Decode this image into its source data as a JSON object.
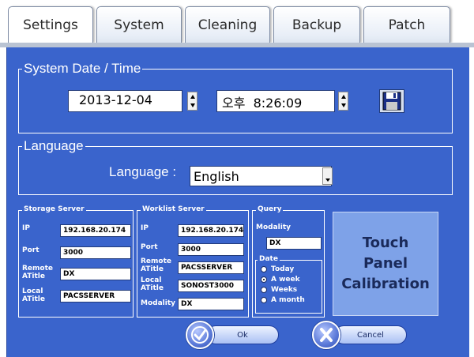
{
  "tabs": [
    "Settings",
    "System",
    "Cleaning",
    "Backup",
    "Patch"
  ],
  "datetime": {
    "title": "System Date / Time",
    "date": "2013-12-04",
    "time": "오후  8:26:09"
  },
  "language": {
    "group_title": "Language",
    "label": "Language :",
    "value": "English"
  },
  "storage": {
    "title": "Storage Server",
    "ip_label": "IP",
    "ip": "192.168.20.174",
    "port_label": "Port",
    "port": "3000",
    "remote_label1": "Remote",
    "remote_label2": "ATitle",
    "remote": "DX",
    "local_label1": "Local",
    "local_label2": "ATitle",
    "local": "PACSSERVER"
  },
  "worklist": {
    "title": "Worklist Server",
    "ip_label": "IP",
    "ip": "192.168.20.174",
    "port_label": "Port",
    "port": "3000",
    "remote_label1": "Remote",
    "remote_label2": "ATitle",
    "remote": "PACSSERVER",
    "local_label1": "Local",
    "local_label2": "ATitle",
    "local": "SONOST3000",
    "modality_label": "Modality",
    "modality": "DX"
  },
  "query": {
    "title": "Query",
    "modality_label": "Modality",
    "modality": "DX",
    "date_title": "Date",
    "options": [
      "Today",
      "A week",
      "Weeks",
      "A month"
    ],
    "selected": "A week"
  },
  "touch_calibration": "Touch\nPanel\nCalibration",
  "buttons": {
    "ok": "Ok",
    "cancel": "Cancel"
  }
}
